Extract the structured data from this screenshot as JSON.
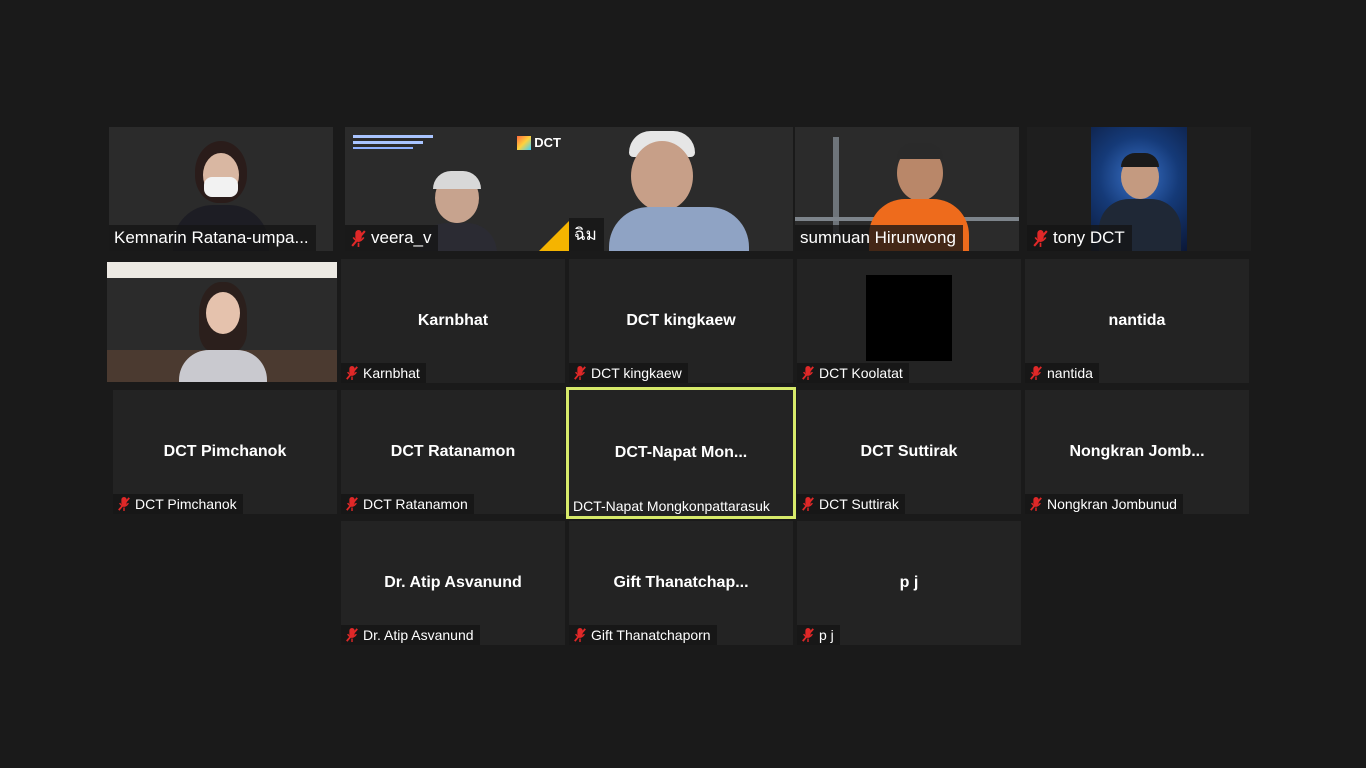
{
  "participants": [
    {
      "tile_label": "Kemnarin Ratana-umpa...",
      "center_name": "",
      "muted": false
    },
    {
      "tile_label": "veera_v",
      "center_name": "",
      "muted": true,
      "logo_text": "DCT"
    },
    {
      "tile_label": "ฉิม",
      "center_name": "",
      "muted": false
    },
    {
      "tile_label": "sumnuan Hirunwong",
      "center_name": "",
      "muted": false
    },
    {
      "tile_label": "tony DCT",
      "center_name": "",
      "muted": true
    },
    {
      "tile_label": "",
      "center_name": "",
      "muted": false
    },
    {
      "tile_label": "Karnbhat",
      "center_name": "Karnbhat",
      "muted": true
    },
    {
      "tile_label": "DCT kingkaew",
      "center_name": "DCT kingkaew",
      "muted": true
    },
    {
      "tile_label": "DCT Koolatat",
      "center_name": "",
      "muted": true
    },
    {
      "tile_label": "nantida",
      "center_name": "nantida",
      "muted": true
    },
    {
      "tile_label": "DCT Pimchanok",
      "center_name": "DCT Pimchanok",
      "muted": true
    },
    {
      "tile_label": "DCT Ratanamon",
      "center_name": "DCT Ratanamon",
      "muted": true
    },
    {
      "tile_label": "DCT-Napat Mongkonpattarasuk",
      "center_name": "DCT-Napat  Mon...",
      "muted": false,
      "active": true
    },
    {
      "tile_label": "DCT Suttirak",
      "center_name": "DCT Suttirak",
      "muted": true
    },
    {
      "tile_label": "Nongkran Jombunud",
      "center_name": "Nongkran  Jomb...",
      "muted": true
    },
    {
      "tile_label": "Dr. Atip Asvanund",
      "center_name": "Dr. Atip Asvanund",
      "muted": true
    },
    {
      "tile_label": "Gift Thanatchaporn",
      "center_name": "Gift  Thanatchap...",
      "muted": true
    },
    {
      "tile_label": "p j",
      "center_name": "p j",
      "muted": true
    }
  ],
  "colors": {
    "background": "#1a1a1a",
    "tile": "#232323",
    "active_border": "#d7ea6a",
    "muted_icon": "#e02828"
  }
}
